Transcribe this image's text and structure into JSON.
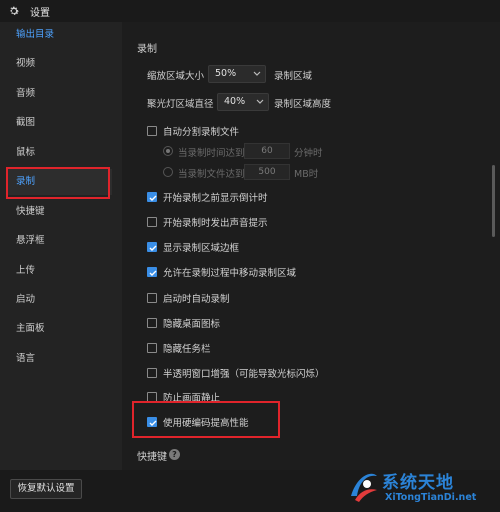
{
  "titlebar": {
    "title": "设置"
  },
  "sidebar": {
    "items": [
      {
        "label": "输出目录"
      },
      {
        "label": "视频"
      },
      {
        "label": "音频"
      },
      {
        "label": "截图"
      },
      {
        "label": "鼠标"
      },
      {
        "label": "录制"
      },
      {
        "label": "快捷键"
      },
      {
        "label": "悬浮框"
      },
      {
        "label": "上传"
      },
      {
        "label": "启动"
      },
      {
        "label": "主面板"
      },
      {
        "label": "语言"
      }
    ]
  },
  "main": {
    "section_title": "录制",
    "zoom_area": {
      "label": "缩放区域大小",
      "value": "50%",
      "suffix": "录制区域"
    },
    "spotlight": {
      "label": "聚光灯区域直径",
      "value": "40%",
      "suffix": "录制区域高度"
    },
    "auto_split": {
      "label": "自动分割录制文件",
      "checked": false
    },
    "split_time": {
      "label": "当录制时间达到",
      "value": "60",
      "unit": "分钟时"
    },
    "split_size": {
      "label": "当录制文件达到",
      "value": "500",
      "unit": "MB时"
    },
    "checkboxes": [
      {
        "label": "开始录制之前显示倒计时",
        "checked": true
      },
      {
        "label": "开始录制时发出声音提示",
        "checked": false
      },
      {
        "label": "显示录制区域边框",
        "checked": true
      },
      {
        "label": "允许在录制过程中移动录制区域",
        "checked": true
      },
      {
        "label": "启动时自动录制",
        "checked": false
      },
      {
        "label": "隐藏桌面图标",
        "checked": false
      },
      {
        "label": "隐藏任务栏",
        "checked": false
      },
      {
        "label": "半透明窗口增强（可能导致光标闪烁）",
        "checked": false
      },
      {
        "label": "防止画面静止",
        "checked": false
      },
      {
        "label": "使用硬编码提高性能",
        "checked": true
      }
    ],
    "shortcut_section": "快捷键"
  },
  "footer": {
    "reset_label": "恢复默认设置"
  },
  "watermark": {
    "title": "系统天地",
    "url": "XiTongTianDi.net"
  },
  "colors": {
    "accent": "#3a8ee6",
    "highlight_box": "#e0242b",
    "watermark": "#2b83d7"
  }
}
